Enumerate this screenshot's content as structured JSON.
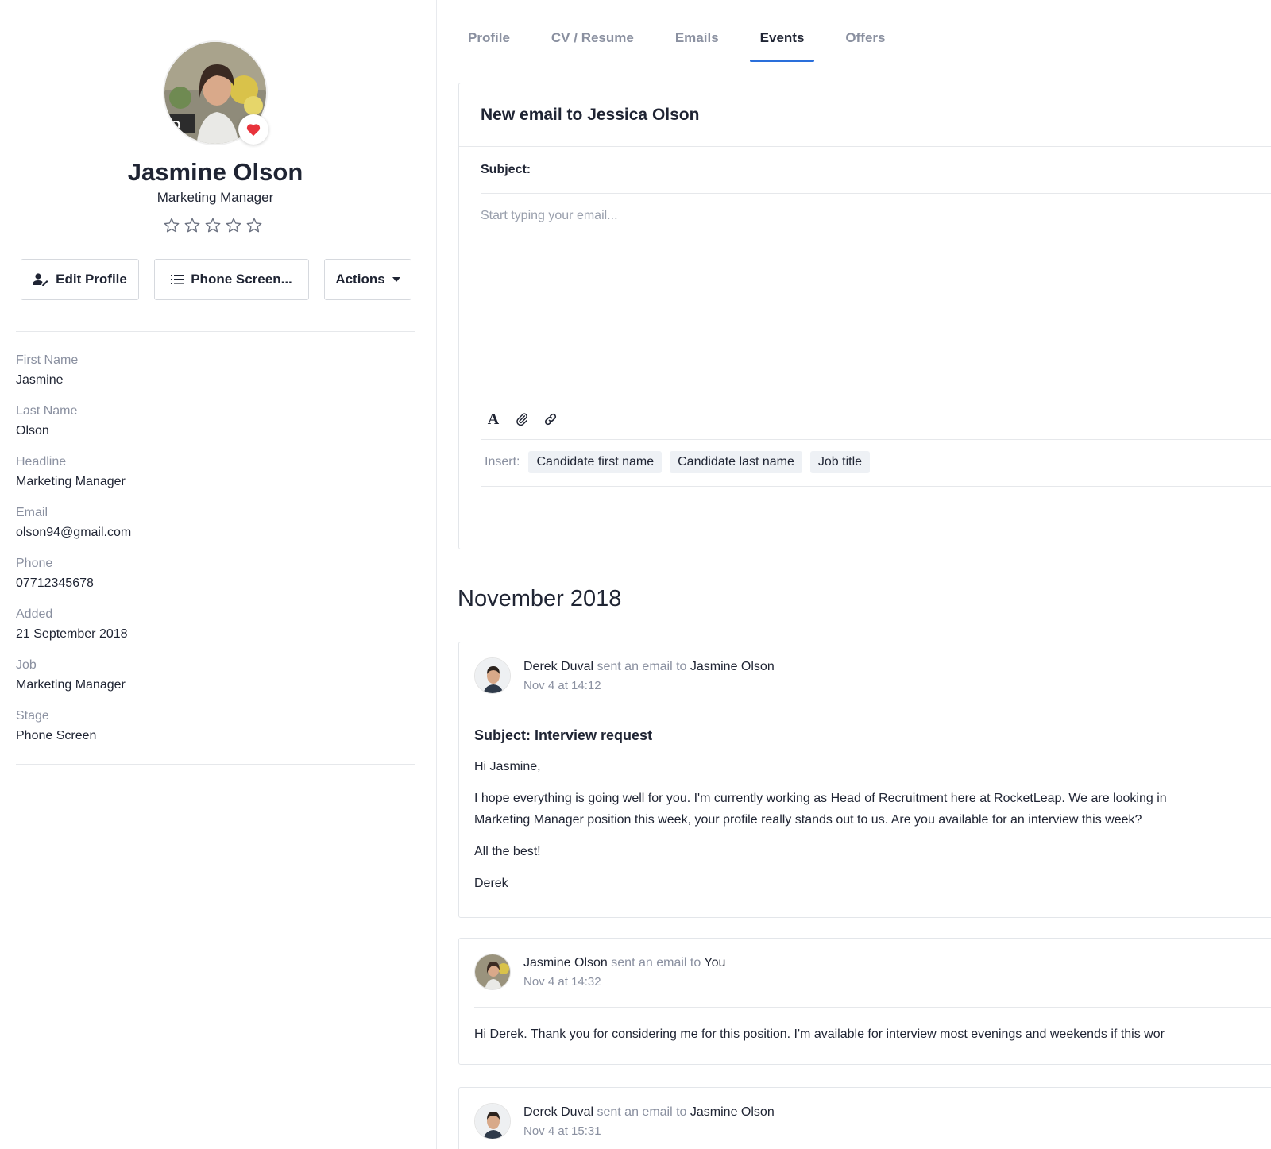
{
  "candidate": {
    "name": "Jasmine Olson",
    "headline": "Marketing Manager",
    "rating": 0,
    "rating_max": 5
  },
  "buttons": {
    "edit": "Edit Profile",
    "stage": "Phone Screen...",
    "actions": "Actions"
  },
  "fields": [
    {
      "label": "First Name",
      "value": "Jasmine"
    },
    {
      "label": "Last Name",
      "value": "Olson"
    },
    {
      "label": "Headline",
      "value": "Marketing Manager"
    },
    {
      "label": "Email",
      "value": "olson94@gmail.com"
    },
    {
      "label": "Phone",
      "value": "07712345678"
    },
    {
      "label": "Added",
      "value": "21 September 2018"
    },
    {
      "label": "Job",
      "value": "Marketing Manager"
    },
    {
      "label": "Stage",
      "value": "Phone Screen"
    }
  ],
  "tabs": [
    {
      "label": "Profile",
      "active": false
    },
    {
      "label": "CV / Resume",
      "active": false
    },
    {
      "label": "Emails",
      "active": false
    },
    {
      "label": "Events",
      "active": true
    },
    {
      "label": "Offers",
      "active": false
    }
  ],
  "compose": {
    "title": "New email to Jessica Olson",
    "subject_label": "Subject:",
    "body_placeholder": "Start typing your email...",
    "insert_label": "Insert:",
    "chips": [
      "Candidate first name",
      "Candidate last name",
      "Job title"
    ]
  },
  "month": "November 2018",
  "events": [
    {
      "actor": "Derek Duval",
      "verb": "sent an email to",
      "target": "Jasmine Olson",
      "time": "Nov 4 at 14:12",
      "subject": "Subject: Interview request",
      "lines": [
        "Hi Jasmine,",
        "I hope everything is going well for you. I'm currently working as Head of Recruitment here at RocketLeap. We are looking in",
        "Marketing Manager position this week, your profile really stands out to us. Are you available for an interview this week?",
        "All the best!",
        "Derek"
      ]
    },
    {
      "actor": "Jasmine Olson",
      "verb": "sent an email to",
      "target": "You",
      "time": "Nov 4 at 14:32",
      "lines": [
        "Hi Derek. Thank you for considering me for this position. I'm available for interview most evenings and weekends if this wor"
      ]
    },
    {
      "actor": "Derek Duval",
      "verb": "sent an email to",
      "target": "Jasmine Olson",
      "time": "Nov 4 at 15:31"
    }
  ],
  "colors": {
    "accent": "#2a6fdb",
    "heart": "#e8333c",
    "muted_text": "#8a90a0",
    "border": "#e3e6ea"
  }
}
